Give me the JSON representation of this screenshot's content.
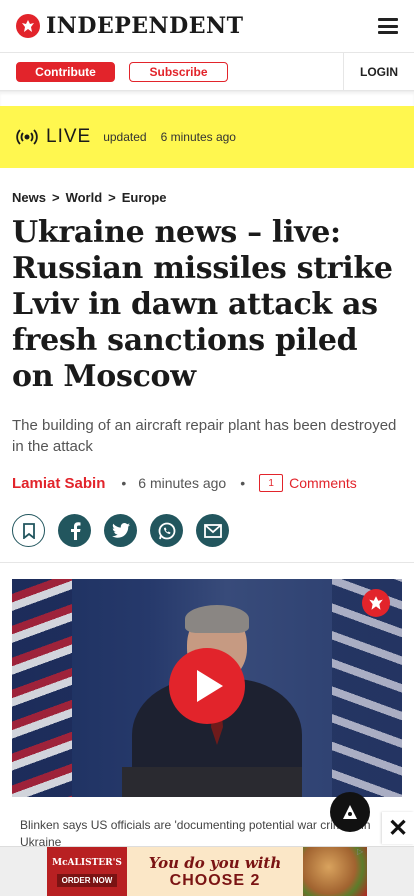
{
  "header": {
    "brand": "INDEPENDENT",
    "contribute_label": "Contribute",
    "subscribe_label": "Subscribe",
    "login_label": "LOGIN"
  },
  "live": {
    "label": "LIVE",
    "updated_label": "updated",
    "updated_time": "6 minutes ago"
  },
  "breadcrumb": {
    "items": [
      "News",
      "World",
      "Europe"
    ],
    "separator": ">"
  },
  "article": {
    "headline": "Ukraine news – live: Russian missiles strike Lviv in dawn attack as fresh sanctions piled on Moscow",
    "standfirst": "The building of an aircraft repair plant has been destroyed in the attack",
    "author": "Lamiat Sabin",
    "time": "6 minutes ago",
    "comment_count": "1",
    "comments_label": "Comments"
  },
  "video": {
    "caption": "Blinken says US officials are 'documenting potential war crimes' in Ukraine"
  },
  "ad": {
    "brand": "McALISTER'S",
    "cta": "ORDER NOW",
    "line1": "You do you with",
    "line2": "CHOOSE 2"
  },
  "colors": {
    "brand_red": "#e2242b",
    "live_yellow": "#fff74f",
    "share_teal": "#22565e"
  }
}
